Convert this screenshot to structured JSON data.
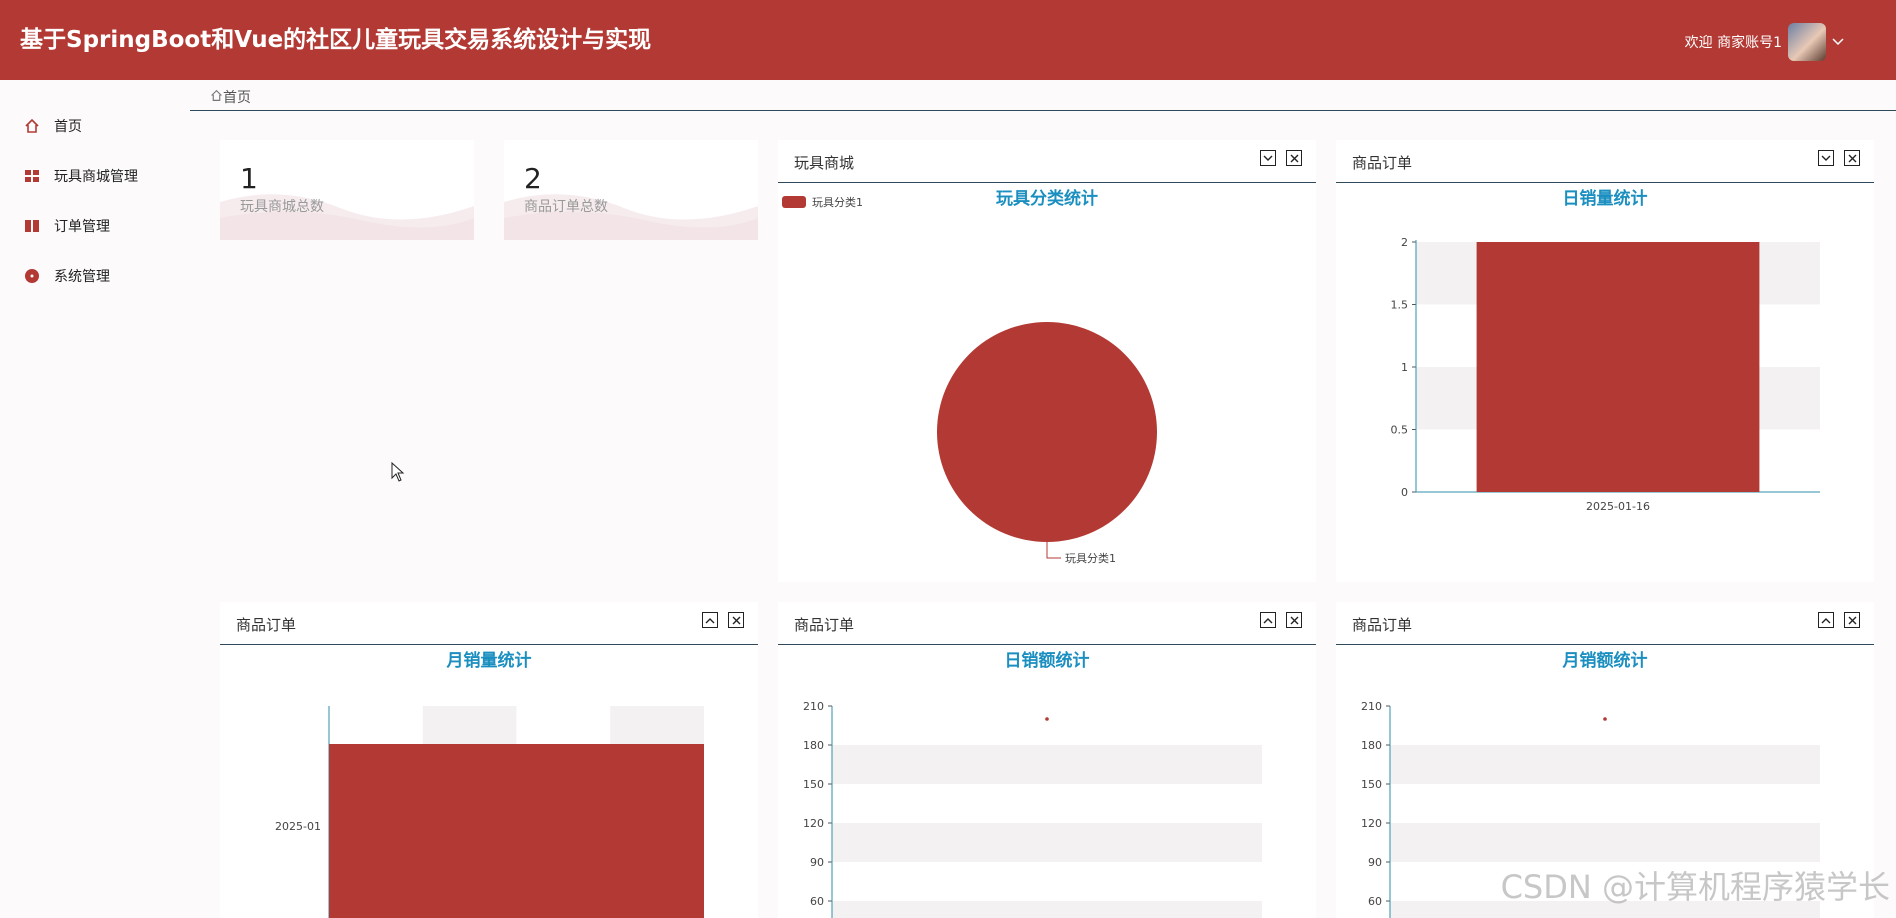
{
  "header": {
    "title": "基于SpringBoot和Vue的社区儿童玩具交易系统设计与实现",
    "welcome": "欢迎 商家账号1"
  },
  "sidebar": {
    "items": [
      {
        "label": "首页",
        "icon": "home-icon"
      },
      {
        "label": "玩具商城管理",
        "icon": "grid-icon"
      },
      {
        "label": "订单管理",
        "icon": "book-icon"
      },
      {
        "label": "系统管理",
        "icon": "circle-icon"
      }
    ]
  },
  "breadcrumb": {
    "home": "首页"
  },
  "stats": [
    {
      "value": "1",
      "label": "玩具商城总数"
    },
    {
      "value": "2",
      "label": "商品订单总数"
    }
  ],
  "colors": {
    "brand": "#b33a34",
    "chart_title": "#1b8fc0",
    "axis": "#2f8fa8"
  },
  "panels": [
    {
      "header": "玩具商城",
      "chart_title": "玩具分类统计"
    },
    {
      "header": "商品订单",
      "chart_title": "日销量统计"
    },
    {
      "header": "商品订单",
      "chart_title": "月销量统计"
    },
    {
      "header": "商品订单",
      "chart_title": "日销额统计"
    },
    {
      "header": "商品订单",
      "chart_title": "月销额统计"
    }
  ],
  "chart_data": [
    {
      "type": "pie",
      "title": "玩具分类统计",
      "legend": [
        "玩具分类1"
      ],
      "slices": [
        {
          "label": "玩具分类1",
          "value": 1
        }
      ],
      "legend_position": "top-left"
    },
    {
      "type": "bar",
      "title": "日销量统计",
      "categories": [
        "2025-01-16"
      ],
      "values": [
        2
      ],
      "ylim": [
        0,
        2
      ],
      "yticks": [
        "0",
        "0.5",
        "1",
        "1.5",
        "2"
      ]
    },
    {
      "type": "bar",
      "title": "月销量统计",
      "orientation": "horizontal",
      "categories": [
        "2025-01"
      ],
      "values": [
        2
      ]
    },
    {
      "type": "scatter",
      "title": "日销额统计",
      "values": [
        200
      ],
      "ylim": [
        0,
        210
      ],
      "yticks": [
        "60",
        "90",
        "120",
        "150",
        "180",
        "210"
      ]
    },
    {
      "type": "scatter",
      "title": "月销额统计",
      "values": [
        200
      ],
      "ylim": [
        0,
        210
      ],
      "yticks": [
        "60",
        "90",
        "120",
        "150",
        "180",
        "210"
      ]
    }
  ],
  "watermark": "CSDN @计算机程序猿学长"
}
